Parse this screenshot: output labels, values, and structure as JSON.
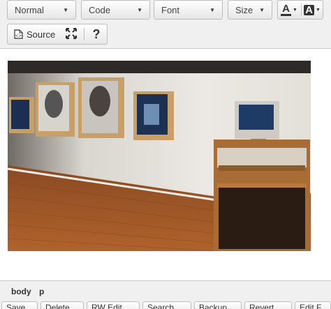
{
  "toolbar": {
    "format": {
      "value": "Normal"
    },
    "code": {
      "value": "Code"
    },
    "font": {
      "value": "Font"
    },
    "size": {
      "value": "Size"
    },
    "text_color": {
      "letter": "A"
    },
    "bg_color": {
      "letter": "A"
    },
    "source_label": "Source",
    "help_label": "?"
  },
  "editor": {
    "image_alt": "Gallery installation: framed illuminated portraits on a white wall with a computer monitor on a wooden cart"
  },
  "path": [
    "body",
    "p"
  ],
  "bottom_tabs": [
    "Save",
    "Delete",
    "RW Edit",
    "Search",
    "Backup",
    "Revert",
    "Edit F"
  ],
  "colors": {
    "toolbar_bg": "#f0f0f0",
    "border": "#bdbdbd",
    "text": "#333333"
  }
}
